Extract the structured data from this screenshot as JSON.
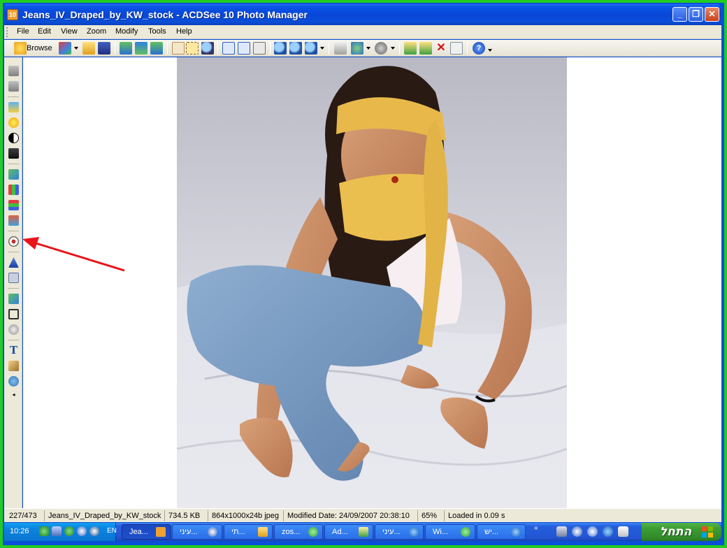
{
  "window": {
    "title": "Jeans_IV_Draped_by_KW_stock - ACDSee 10 Photo Manager",
    "app_icon": "acdsee-icon",
    "controls": {
      "minimize": "minimize-icon",
      "maximize": "restore-icon",
      "close": "close-icon"
    }
  },
  "menu": [
    "File",
    "Edit",
    "View",
    "Zoom",
    "Modify",
    "Tools",
    "Help"
  ],
  "toolbar": {
    "browse_label": "Browse",
    "icons": [
      "browse-icon",
      "edit-paint-icon",
      "open-folder-icon",
      "save-icon",
      "prev-image-icon",
      "slideshow-icon",
      "next-image-icon",
      "hand-tool-icon",
      "select-tool-icon",
      "zoom-tool-icon",
      "rotate-left-icon",
      "rotate-right-icon",
      "fit-icon",
      "zoom-in-icon",
      "zoom-out-icon",
      "zoom-icon",
      "print-icon",
      "send-icon",
      "rating-icon",
      "move-icon",
      "copy-icon",
      "delete-icon",
      "properties-icon",
      "help-icon"
    ]
  },
  "sidebar_icons": [
    "undo-icon",
    "redo-icon",
    "auto-exposure-icon",
    "lighting-icon",
    "contrast-icon",
    "shadow-highlight-icon",
    "levels-icon",
    "histogram-icon",
    "color-balance-icon",
    "color-icon",
    "red-eye-icon",
    "sharpen-icon",
    "noise-icon",
    "effects-icon",
    "crop-icon",
    "rotate-icon",
    "text-icon",
    "repair-icon",
    "watermark-icon",
    "more-icon"
  ],
  "annotation": {
    "arrow_color": "#e8151a",
    "points_to": "red-eye-icon"
  },
  "status": {
    "index": "227/473",
    "filename": "Jeans_IV_Draped_by_KW_stock",
    "size": "734.5 KB",
    "dims": "864x1000x24b jpeg",
    "modified": "Modified Date: 24/09/2007 20:38:10",
    "zoom": "65%",
    "loaded": "Loaded in 0.09 s"
  },
  "taskbar": {
    "clock": "10:26",
    "lang": "EN",
    "tasks": [
      {
        "label": "Jea...",
        "icon": "acdsee-icon",
        "active": true
      },
      {
        "label": "עיני...",
        "icon": "app-icon",
        "active": false
      },
      {
        "label": "תי...",
        "icon": "folder-icon",
        "active": false
      },
      {
        "label": "zos...",
        "icon": "chat-icon",
        "active": false
      },
      {
        "label": "Ad...",
        "icon": "editor-icon",
        "active": false
      },
      {
        "label": "עיני...",
        "icon": "ie-icon",
        "active": false
      },
      {
        "label": "Wi...",
        "icon": "messenger-icon",
        "active": false
      },
      {
        "label": "יש...",
        "icon": "ie-icon",
        "active": false
      }
    ],
    "chevron": "«",
    "start_label": "התחל"
  },
  "colors": {
    "titlebar": "#0a4fd8",
    "taskbar": "#245edb",
    "start": "#3c9d33",
    "frame": "#22cc22"
  }
}
